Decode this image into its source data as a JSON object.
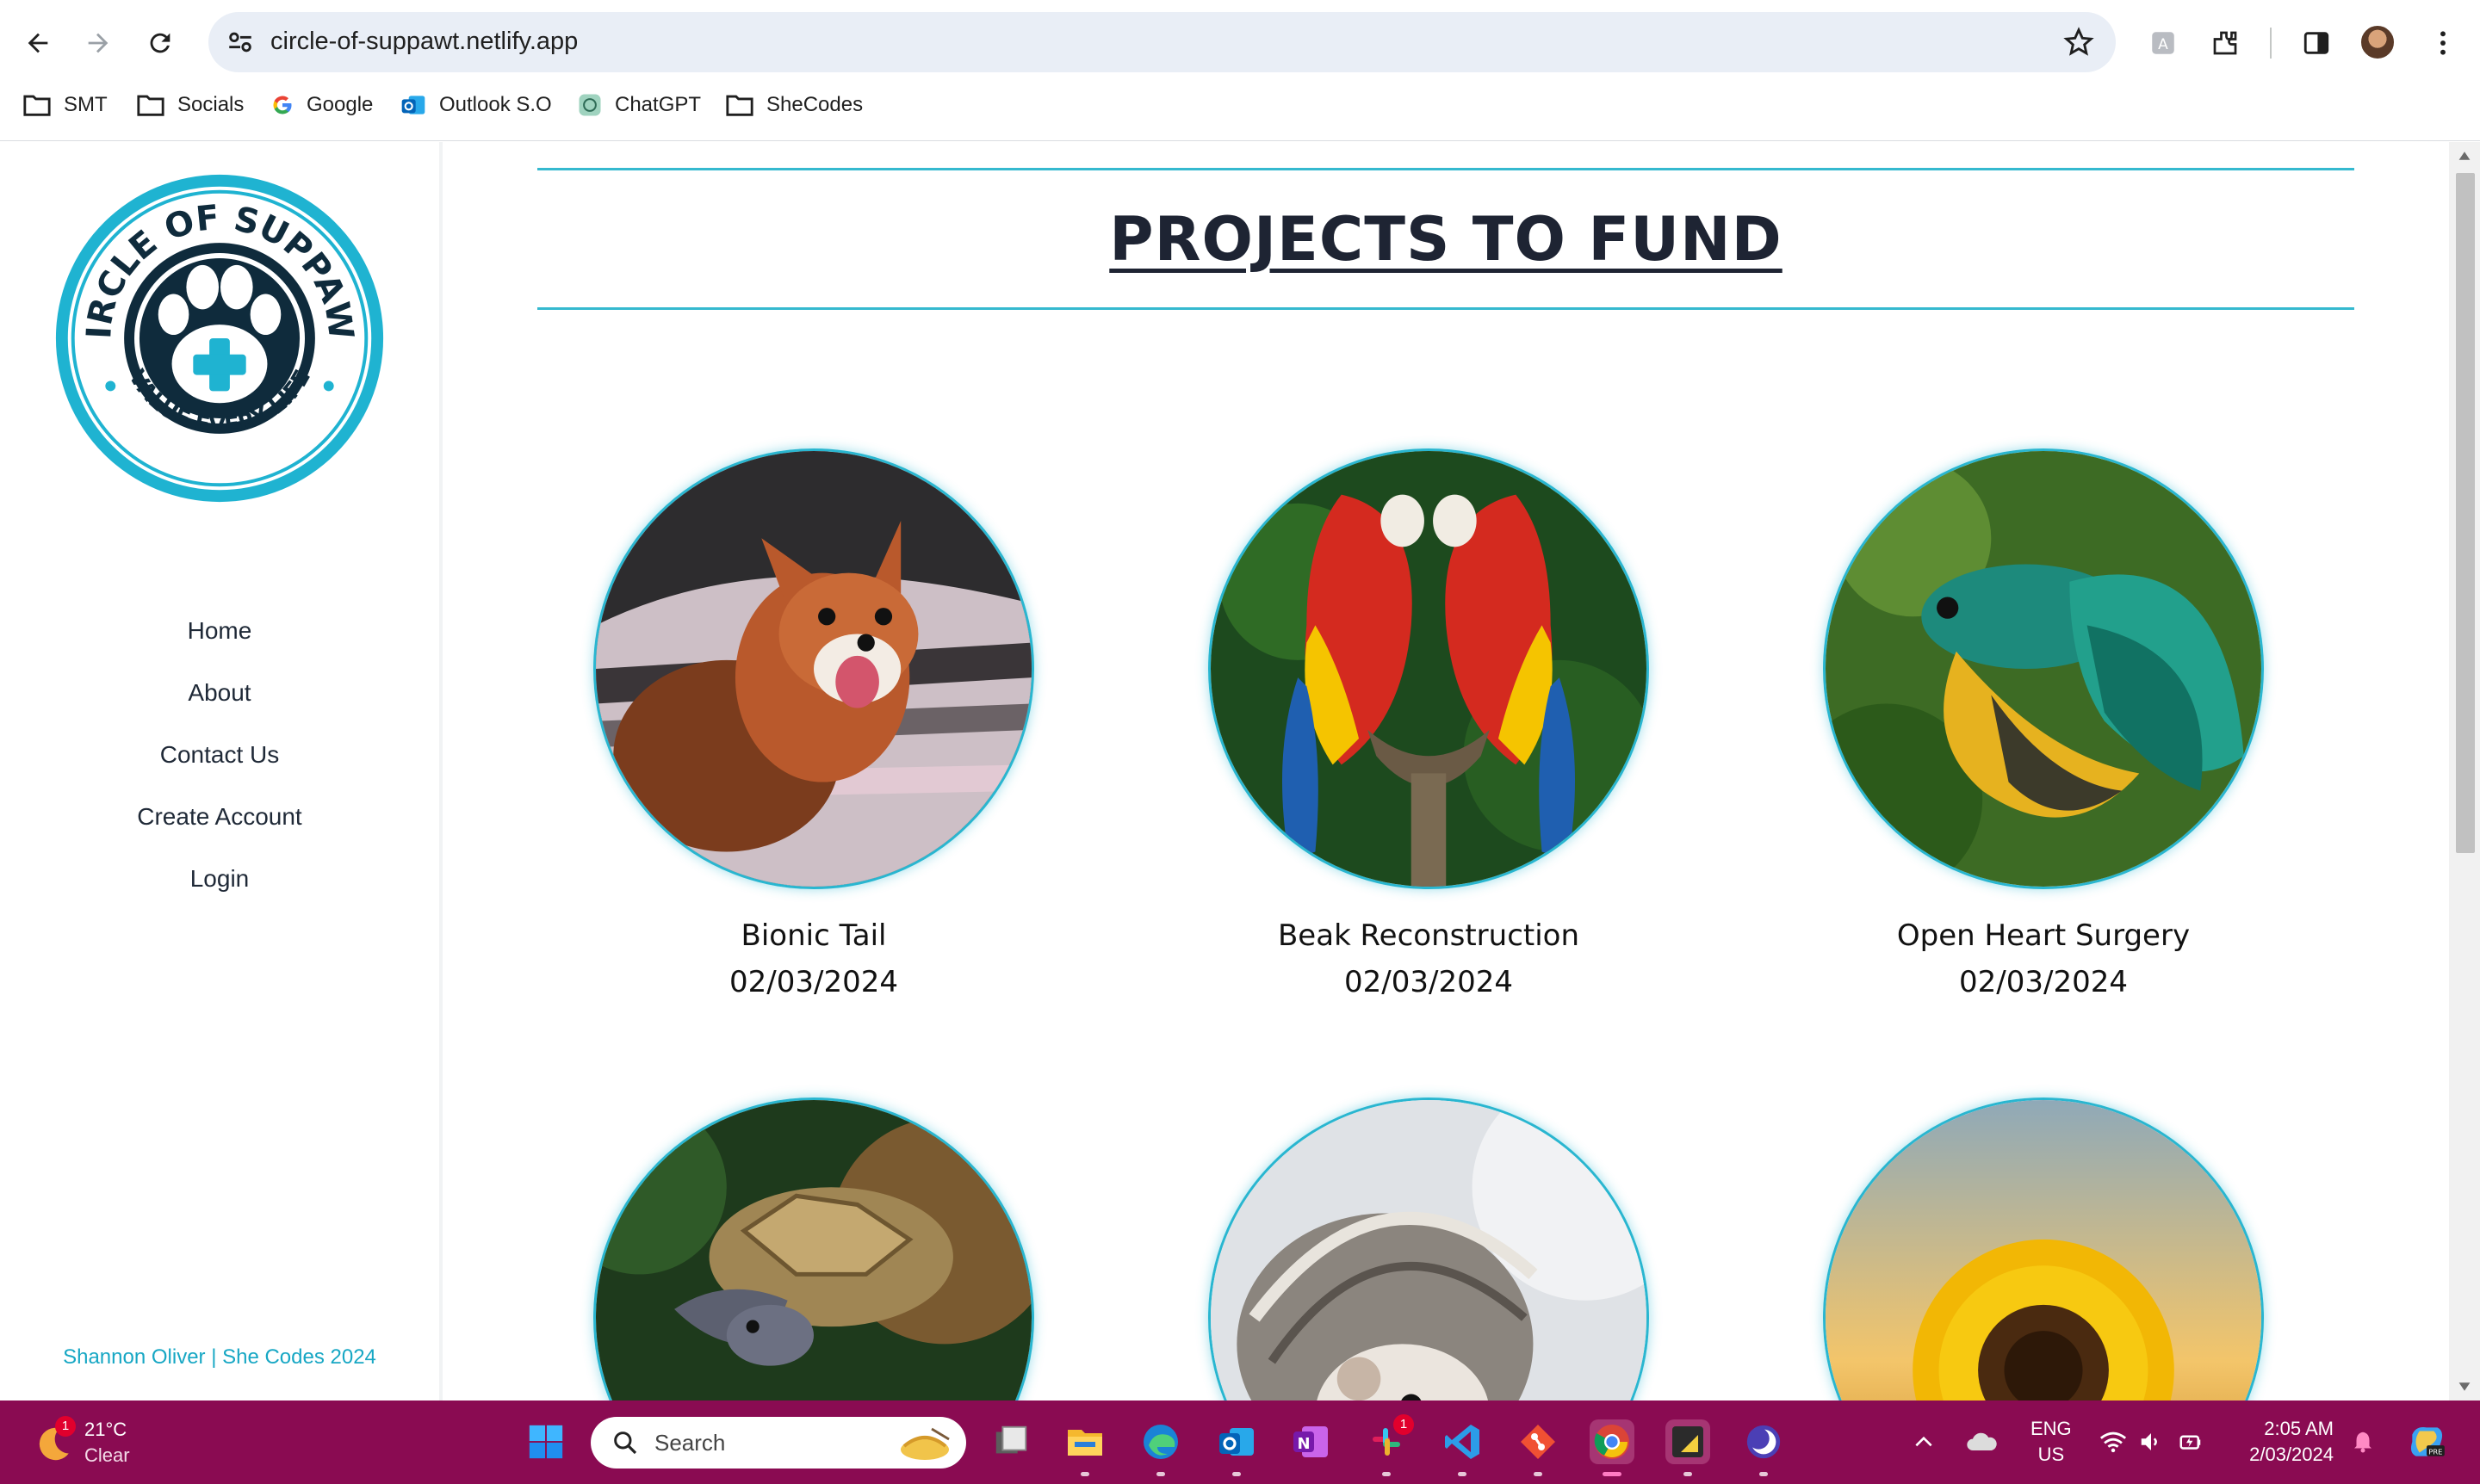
{
  "browser": {
    "url": "circle-of-suppawt.netlify.app",
    "bookmarks": [
      "SMT",
      "Socials",
      "Google",
      "Outlook S.O",
      "ChatGPT",
      "SheCodes"
    ]
  },
  "sidebar": {
    "logo_text_top": "CIRCLE OF SUPPAWT",
    "logo_text_bottom": "VALUE EVERY LIFE",
    "links": [
      "Home",
      "About",
      "Contact Us",
      "Create Account",
      "Login"
    ],
    "footer": "Shannon Oliver | She Codes 2024"
  },
  "main": {
    "title": "PROJECTS TO FUND",
    "projects": [
      {
        "name": "Bionic Tail",
        "date": "02/03/2024",
        "image": "fox-photo"
      },
      {
        "name": "Beak Reconstruction",
        "date": "02/03/2024",
        "image": "parrots-photo"
      },
      {
        "name": "Open Heart Surgery",
        "date": "02/03/2024",
        "image": "betta-fish-photo"
      },
      {
        "name": "",
        "date": "",
        "image": "turtle-photo"
      },
      {
        "name": "",
        "date": "",
        "image": "hedgehog-photo"
      },
      {
        "name": "",
        "date": "",
        "image": "sunflower-photo"
      }
    ]
  },
  "taskbar": {
    "weather_temp": "21°C",
    "weather_cond": "Clear",
    "weather_badge": "1",
    "search_placeholder": "Search",
    "slack_badge": "1",
    "lang_line1": "ENG",
    "lang_line2": "US",
    "time": "2:05 AM",
    "date": "2/03/2024"
  },
  "colors": {
    "accent": "#29b6d0",
    "title": "#1e2433",
    "taskbar": "#8a0b52"
  }
}
